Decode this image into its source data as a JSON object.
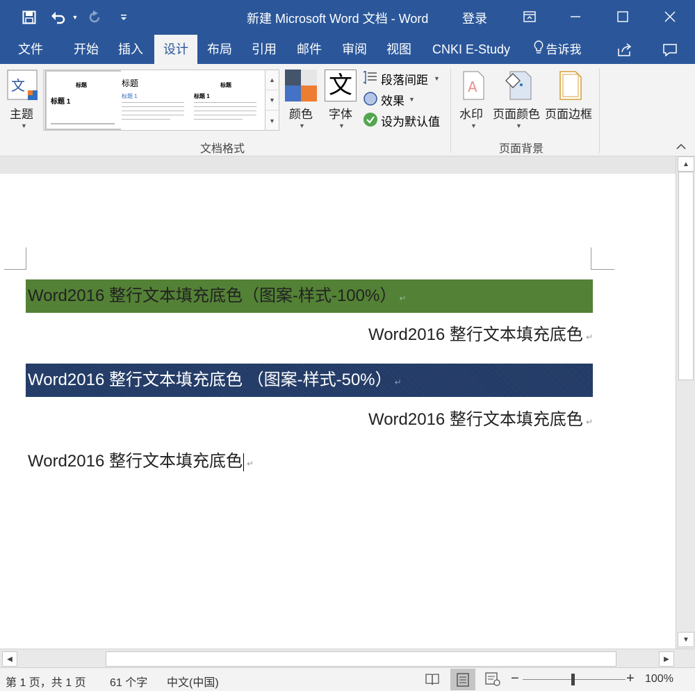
{
  "titlebar": {
    "title": "新建 Microsoft Word 文档 - Word",
    "login": "登录",
    "save_icon": "save-icon",
    "undo_icon": "undo-icon",
    "redo_icon": "redo-icon"
  },
  "tabs": [
    {
      "label": "文件"
    },
    {
      "label": "开始"
    },
    {
      "label": "插入"
    },
    {
      "label": "设计"
    },
    {
      "label": "布局"
    },
    {
      "label": "引用"
    },
    {
      "label": "邮件"
    },
    {
      "label": "审阅"
    },
    {
      "label": "视图"
    },
    {
      "label": "CNKI E-Study"
    },
    {
      "label": "告诉我"
    }
  ],
  "ribbon": {
    "theme_label": "主题",
    "gallery": {
      "thumb1_title": "标题",
      "thumb1_heading": "标题 1",
      "thumb2_title": "标题",
      "thumb2_heading": "标题 1",
      "thumb3_title": "标题",
      "thumb3_heading": "标题 1"
    },
    "colors_label": "颜色",
    "fonts_glyph": "文",
    "fonts_label": "字体",
    "paragraph_spacing": "段落间距",
    "effects": "效果",
    "set_default": "设为默认值",
    "group_doc_format": "文档格式",
    "watermark": "水印",
    "page_color": "页面颜色",
    "page_borders": "页面边框",
    "group_page_bg": "页面背景"
  },
  "document": {
    "lines": [
      "Word2016 整行文本填充底色（图案-样式-100%）",
      "Word2016 整行文本填充底色",
      "Word2016 整行文本填充底色 （图案-样式-50%）",
      "Word2016 整行文本填充底色",
      "Word2016 整行文本填充底色"
    ],
    "para_mark": "↵"
  },
  "statusbar": {
    "page": "第 1 页，共 1 页",
    "words": "61 个字",
    "language": "中文(中国)",
    "zoom": "100%"
  },
  "colors": {
    "title_blue": "#2b579a",
    "shade_green": "#538135",
    "shade_navy": "#1f3864"
  }
}
